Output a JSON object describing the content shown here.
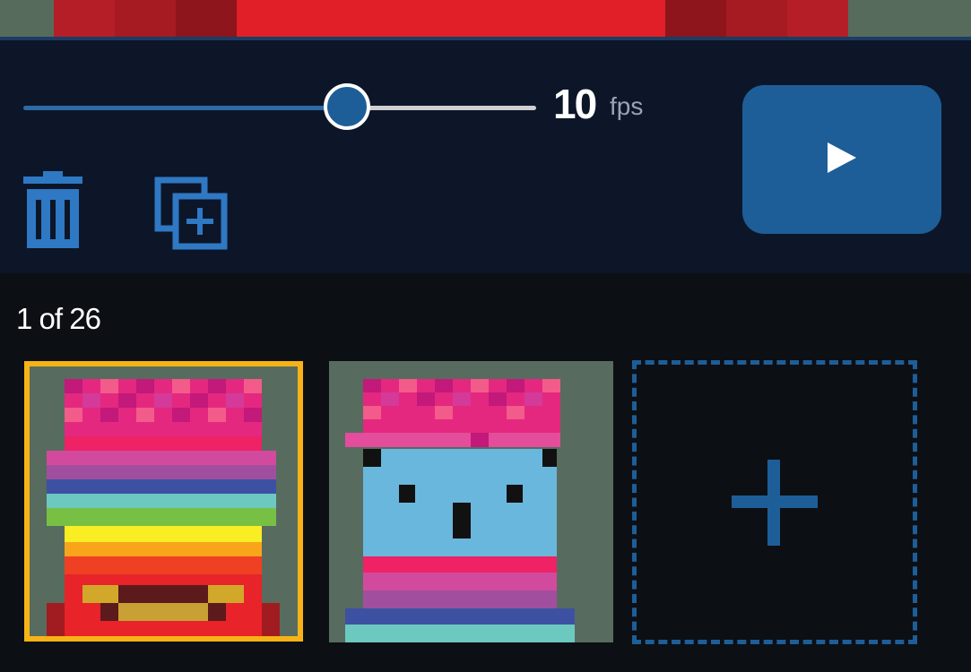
{
  "colors": {
    "accent": "#1d5e98",
    "selected_frame": "#f7b316",
    "panel_bg": "#0c1628",
    "canvas_bg": "#566b5c"
  },
  "speed_slider": {
    "value": 10,
    "value_label": "10",
    "unit": "fps",
    "position_fraction": 0.63
  },
  "toolbar": {
    "delete_icon": "trash-icon",
    "duplicate_icon": "duplicate-frame-icon",
    "play_icon": "play-icon"
  },
  "frames": {
    "current": 1,
    "total": 26,
    "counter_text": "1 of 26",
    "add_icon": "plus-icon"
  }
}
